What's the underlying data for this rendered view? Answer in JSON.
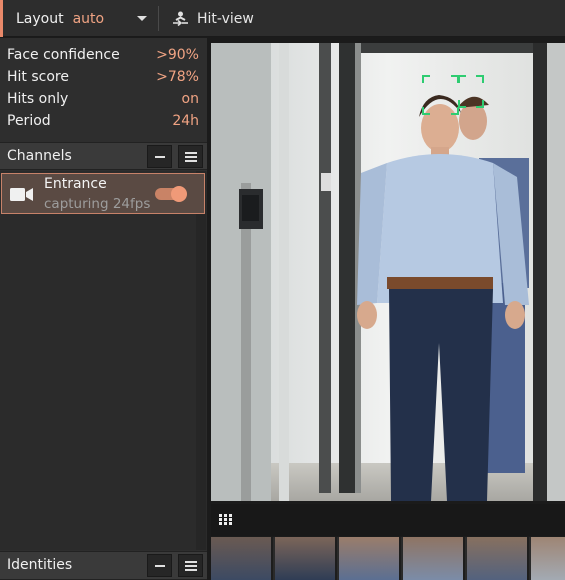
{
  "toolbar": {
    "layout_label": "Layout",
    "layout_value": "auto",
    "caret_icon": "caret-down-icon",
    "hitview_icon": "person-swap-icon",
    "hitview_label": "Hit-view",
    "accent_color": "#e9896a"
  },
  "stats": [
    {
      "label": "Face confidence",
      "value": ">90%"
    },
    {
      "label": "Hit score",
      "value": ">78%"
    },
    {
      "label": "Hits only",
      "value": "on"
    },
    {
      "label": "Period",
      "value": "24h"
    }
  ],
  "channels": {
    "title": "Channels",
    "items": [
      {
        "name": "Entrance",
        "status": "capturing 24fps",
        "enabled": true,
        "icon": "video-camera-icon"
      }
    ]
  },
  "identities": {
    "title": "Identities"
  },
  "video": {
    "face_box_count": 2
  },
  "thumbnails": {
    "grid_icon": "grid-icon",
    "count": 6
  }
}
